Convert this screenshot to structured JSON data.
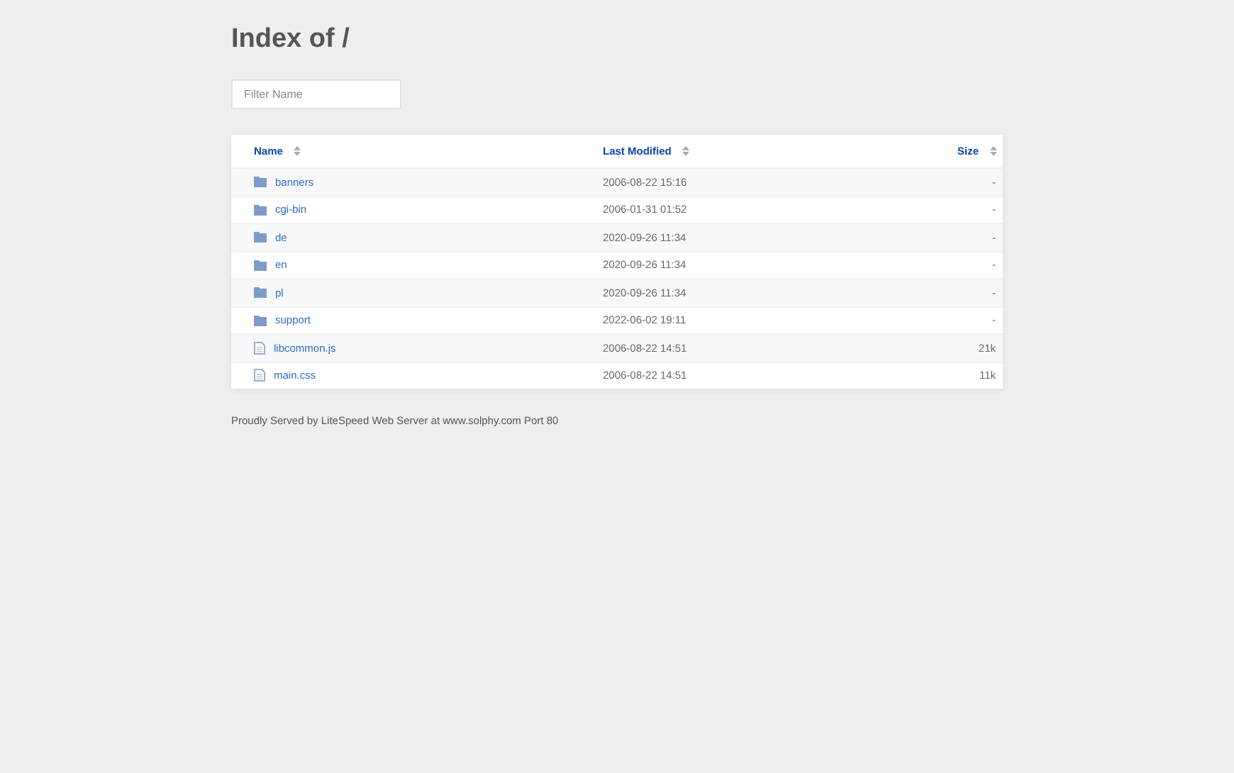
{
  "title": "Index of /",
  "filter": {
    "placeholder": "Filter Name"
  },
  "table": {
    "columns": [
      "Name",
      "Last Modified",
      "Size"
    ],
    "rows": [
      {
        "kind": "folder",
        "name": "banners",
        "modified": "2006-08-22 15:16",
        "size": "-"
      },
      {
        "kind": "folder",
        "name": "cgi-bin",
        "modified": "2006-01-31 01:52",
        "size": "-"
      },
      {
        "kind": "folder",
        "name": "de",
        "modified": "2020-09-26 11:34",
        "size": "-"
      },
      {
        "kind": "folder",
        "name": "en",
        "modified": "2020-09-26 11:34",
        "size": "-"
      },
      {
        "kind": "folder",
        "name": "pl",
        "modified": "2020-09-26 11:34",
        "size": "-"
      },
      {
        "kind": "folder",
        "name": "support",
        "modified": "2022-06-02 19:11",
        "size": "-"
      },
      {
        "kind": "file",
        "name": "libcommon.js",
        "modified": "2006-08-22 14:51",
        "size": "21k"
      },
      {
        "kind": "file",
        "name": "main.css",
        "modified": "2006-08-22 14:51",
        "size": "11k"
      }
    ]
  },
  "footer": "Proudly Served by LiteSpeed Web Server at www.solphy.com Port 80"
}
